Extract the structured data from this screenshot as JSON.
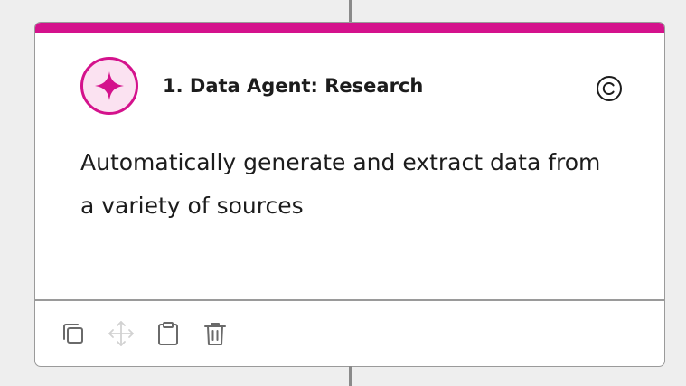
{
  "card": {
    "title": "1. Data Agent: Research",
    "description": "Automatically generate and extract data from a variety of sources",
    "accent_color": "#d4128c",
    "agent_icon": "sparkle-icon",
    "status_icon": "copyright-icon"
  },
  "toolbar": {
    "items": [
      {
        "icon": "copy-icon",
        "enabled": true
      },
      {
        "icon": "move-icon",
        "enabled": false
      },
      {
        "icon": "clipboard-icon",
        "enabled": true
      },
      {
        "icon": "trash-icon",
        "enabled": true
      }
    ]
  }
}
